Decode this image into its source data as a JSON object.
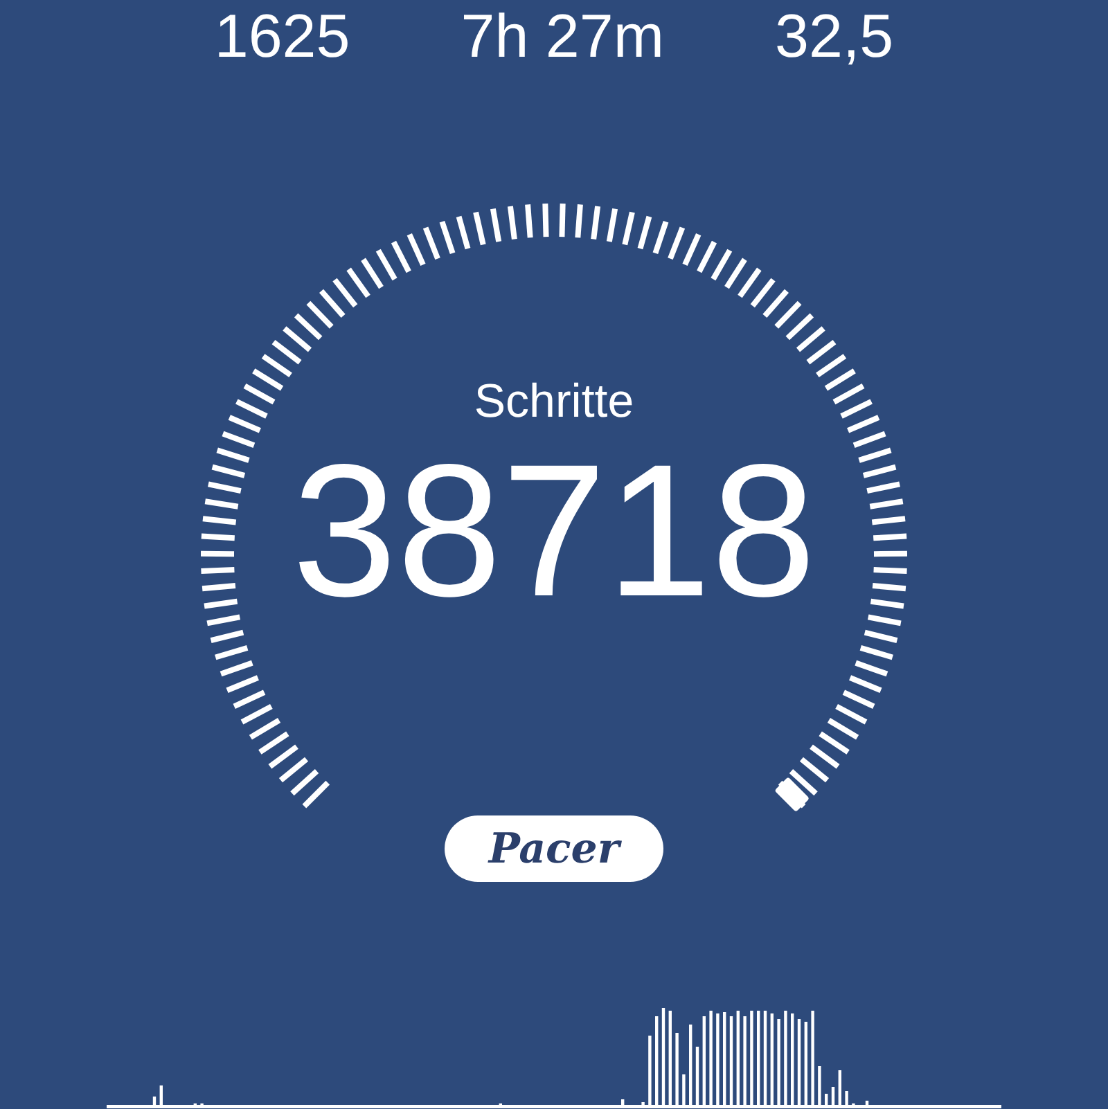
{
  "stats": [
    {
      "value": "1625"
    },
    {
      "value": "7h 27m"
    },
    {
      "value": "32,5"
    }
  ],
  "gauge": {
    "label": "Schritte",
    "value": "38718"
  },
  "badge": {
    "text": "Pacer"
  }
}
